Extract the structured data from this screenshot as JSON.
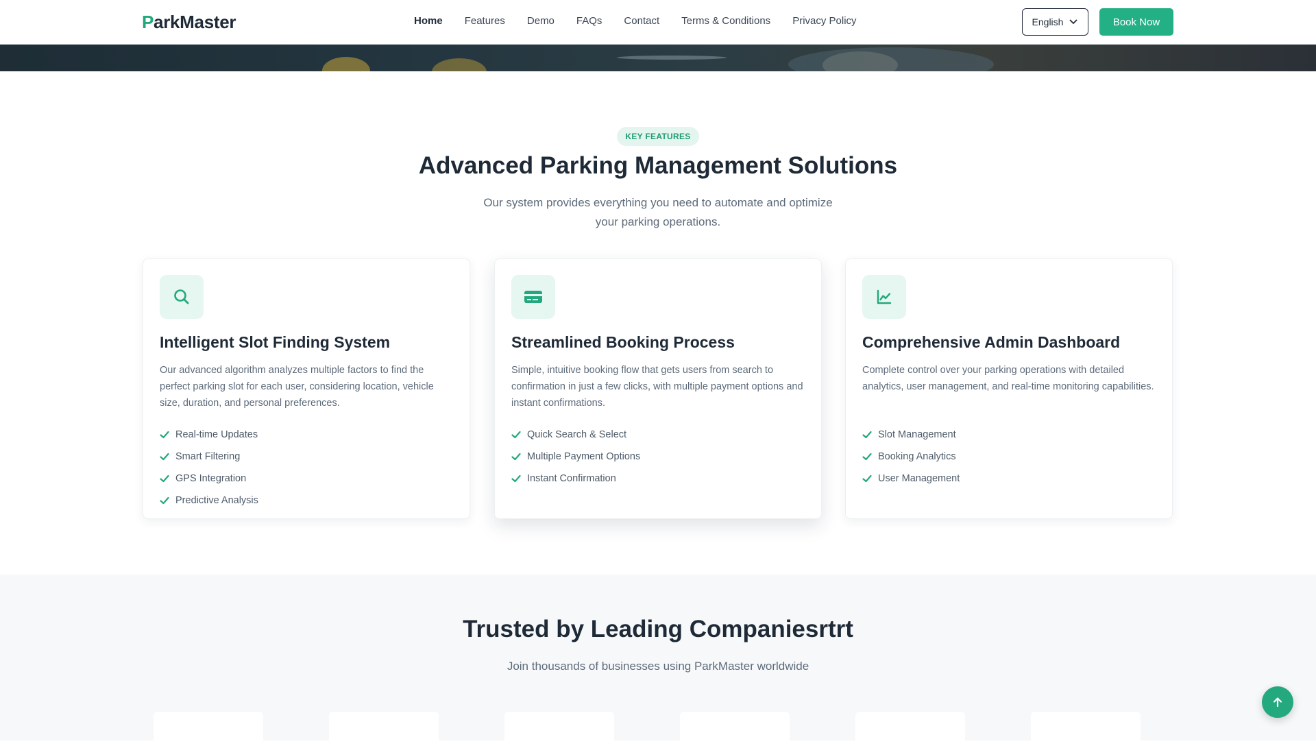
{
  "header": {
    "logo_prefix": "P",
    "logo_rest": "arkMaster",
    "nav": [
      {
        "label": "Home",
        "active": true
      },
      {
        "label": "Features"
      },
      {
        "label": "Demo"
      },
      {
        "label": "FAQs"
      },
      {
        "label": "Contact"
      },
      {
        "label": "Terms & Conditions"
      },
      {
        "label": "Privacy Policy"
      }
    ],
    "language": "English",
    "book_label": "Book Now"
  },
  "features": {
    "badge": "KEY FEATURES",
    "title": "Advanced Parking Management Solutions",
    "subtitle": "Our system provides everything you need to automate and optimize your parking operations.",
    "cards": [
      {
        "icon": "search-icon",
        "title": "Intelligent Slot Finding System",
        "description": "Our advanced algorithm analyzes multiple factors to find the perfect parking slot for each user, considering location, vehicle size, duration, and personal preferences.",
        "items": [
          "Real-time Updates",
          "Smart Filtering",
          "GPS Integration",
          "Predictive Analysis"
        ]
      },
      {
        "icon": "credit-card-icon",
        "title": "Streamlined Booking Process",
        "description": "Simple, intuitive booking flow that gets users from search to confirmation in just a few clicks, with multiple payment options and instant confirmations.",
        "items": [
          "Quick Search & Select",
          "Multiple Payment Options",
          "Instant Confirmation"
        ]
      },
      {
        "icon": "chart-line-icon",
        "title": "Comprehensive Admin Dashboard",
        "description": "Complete control over your parking operations with detailed analytics, user management, and real-time monitoring capabilities.",
        "items": [
          "Slot Management",
          "Booking Analytics",
          "User Management"
        ]
      }
    ]
  },
  "trusted": {
    "title": "Trusted by Leading Companiesrtrt",
    "subtitle": "Join thousands of businesses using ParkMaster worldwide"
  },
  "colors": {
    "accent": "#24b085",
    "text_dark": "#1f2a37",
    "text_muted": "#5d6b7a"
  }
}
